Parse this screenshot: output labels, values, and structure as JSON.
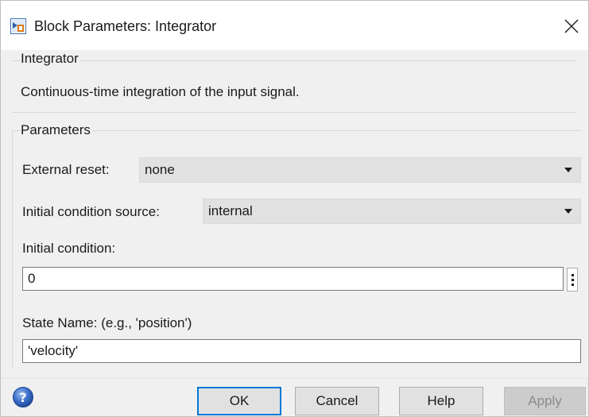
{
  "window": {
    "title": "Block Parameters: Integrator",
    "icon": "simulink-block-icon",
    "close_icon": "close-icon"
  },
  "block_group": {
    "legend": "Integrator",
    "description": "Continuous-time integration of the input signal."
  },
  "parameters": {
    "legend": "Parameters",
    "external_reset": {
      "label": "External reset:",
      "value": "none"
    },
    "initial_condition_source": {
      "label": "Initial condition source:",
      "value": "internal"
    },
    "initial_condition": {
      "label": "Initial condition:",
      "value": "0"
    },
    "state_name": {
      "label": "State Name: (e.g., 'position')",
      "value": "'velocity'"
    }
  },
  "buttons": {
    "ok": "OK",
    "cancel": "Cancel",
    "help": "Help",
    "apply": "Apply"
  },
  "colors": {
    "default_button_border": "#0078d7",
    "dialog_background": "#f0f0f0",
    "help_icon": "#3a6cc8"
  }
}
